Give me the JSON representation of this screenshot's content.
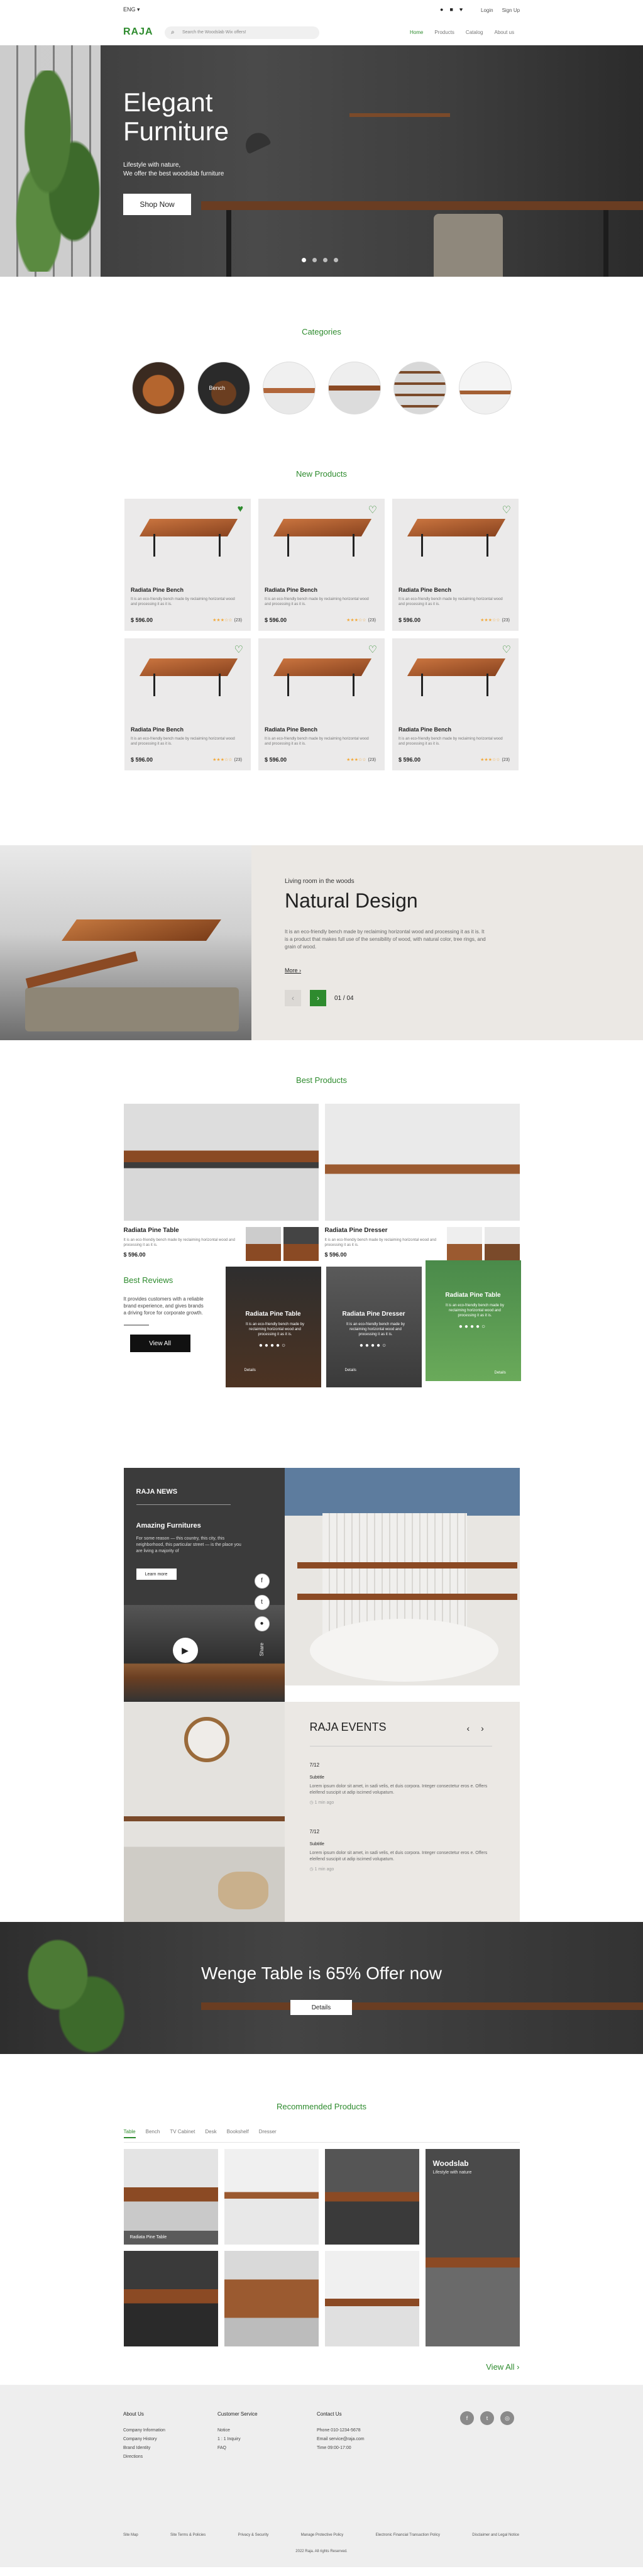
{
  "header": {
    "lang": "ENG",
    "logo": "RAJA",
    "search_placeholder": "Search the Woodslab Wix offers!",
    "login": "Login",
    "signup": "Sign Up",
    "nav": [
      "Home",
      "Products",
      "Catalog",
      "About us"
    ]
  },
  "hero": {
    "title_line1": "Elegant",
    "title_line2": "Furniture",
    "subtitle_line1": "Lifestyle with nature,",
    "subtitle_line2": "We offer the best woodslab furniture",
    "cta": "Shop Now"
  },
  "categories": {
    "title": "Categories",
    "items": [
      "",
      "Bench",
      "",
      "",
      "",
      ""
    ]
  },
  "new_products": {
    "title": "New Products",
    "items": [
      {
        "name": "Radiata Pine Bench",
        "desc": "It is an eco-friendly bench made by reclaiming horizontal wood and processing it as it is.",
        "price": "$ 596.00",
        "reviews": "(23)",
        "rating": 3
      },
      {
        "name": "Radiata Pine Bench",
        "desc": "It is an eco-friendly bench made by reclaiming horizontal wood and processing it as it is.",
        "price": "$ 596.00",
        "reviews": "(23)",
        "rating": 3
      },
      {
        "name": "Radiata Pine Bench",
        "desc": "It is an eco-friendly bench made by reclaiming horizontal wood and processing it as it is.",
        "price": "$ 596.00",
        "reviews": "(23)",
        "rating": 3
      },
      {
        "name": "Radiata Pine Bench",
        "desc": "It is an eco-friendly bench made by reclaiming horizontal wood and processing it as it is.",
        "price": "$ 596.00",
        "reviews": "(23)",
        "rating": 3
      },
      {
        "name": "Radiata Pine Bench",
        "desc": "It is an eco-friendly bench made by reclaiming horizontal wood and processing it as it is.",
        "price": "$ 596.00",
        "reviews": "(23)",
        "rating": 3
      },
      {
        "name": "Radiata Pine Bench",
        "desc": "It is an eco-friendly bench made by reclaiming horizontal wood and processing it as it is.",
        "price": "$ 596.00",
        "reviews": "(23)",
        "rating": 3
      }
    ]
  },
  "natural": {
    "small": "Living room in the woods",
    "title": "Natural Design",
    "desc": "It is an eco-friendly bench made by reclaiming horizontal wood and processing it as it is. It is a product that makes full use of the sensibility of wood, with natural color, tree rings, and grain of wood.",
    "more": "More",
    "page": "01 / 04"
  },
  "best_products": {
    "title": "Best Products",
    "items": [
      {
        "name": "Radiata Pine Table",
        "desc": "It is an eco-friendly bench made by reclaiming horizontal wood and processing it as it is.",
        "price": "$ 596.00"
      },
      {
        "name": "Radiata Pine Dresser",
        "desc": "It is an eco-friendly bench made by reclaiming horizontal wood and processing it as it is.",
        "price": "$ 596.00"
      }
    ]
  },
  "reviews": {
    "title": "Best Reviews",
    "desc": "It provides customers with a reliable brand experience, and gives brands a driving force for corporate growth.",
    "view_all": "View All",
    "cards": [
      {
        "name": "Radiata Pine Table",
        "text": "It is an eco-friendly bench made by reclaiming horizontal wood and processing it as it is.",
        "meta": "Details"
      },
      {
        "name": "Radiata Pine Dresser",
        "text": "It is an eco-friendly bench made by reclaiming horizontal wood and processing it as it is.",
        "meta": "Details"
      },
      {
        "name": "Radiata Pine Table",
        "text": "It is an eco-friendly bench made by reclaiming horizontal wood and processing it as it is.",
        "meta": "Details"
      }
    ]
  },
  "news": {
    "title": "RAJA NEWS",
    "article_title": "Amazing Furnitures",
    "article_text": "For some reason — this country, this city, this neighborhood, this particular street — is the place you are living a majority of",
    "learn_more": "Learn more",
    "share": "Share"
  },
  "events": {
    "title": "RAJA EVENTS",
    "items": [
      {
        "date": "7/12",
        "sub": "Subtitle",
        "body": "Lorem ipsum dolor sit amet, in sadi velis, et duis corpora. Integer consectetur eros e. Offers eleifend suscipit ut adip iscimed volupatum.",
        "time": "1 min ago"
      },
      {
        "date": "7/12",
        "sub": "Subtitle",
        "body": "Lorem ipsum dolor sit amet, in sadi velis, et duis corpora. Integer consectetur eros e. Offers eleifend suscipit ut adip iscimed volupatum.",
        "time": "1 min ago"
      }
    ]
  },
  "offer": {
    "title": "Wenge Table is 65% Offer now",
    "button": "Details"
  },
  "recommended": {
    "title": "Recommended Products",
    "tabs": [
      "Table",
      "Bench",
      "TV Cabinet",
      "Desk",
      "Bookshelf",
      "Dresser"
    ],
    "tile1_caption": "Radiata Pine Table",
    "promo_title": "Woodslab",
    "promo_sub": "Lifestyle with nature",
    "view_all": "View All"
  },
  "footer": {
    "about": {
      "title": "About Us",
      "items": [
        "Company Information",
        "Company History",
        "Brand Identity",
        "Directions"
      ]
    },
    "service": {
      "title": "Customer Service",
      "items": [
        "Notice",
        "1 : 1 Inquiry",
        "FAQ"
      ]
    },
    "contact": {
      "title": "Contact Us",
      "items": [
        "Phone 010-1234-5678",
        "Email service@raja.com",
        "Time 09:00-17:00"
      ]
    },
    "bottom_links": [
      "Site Map",
      "Site Terms & Policies",
      "Privacy & Security",
      "Manage Protective Policy",
      "Electronic Financial Transaction Policy",
      "Disclaimer and Legal Notice"
    ],
    "copyright": "2022 Raja. All rights Reserved."
  }
}
